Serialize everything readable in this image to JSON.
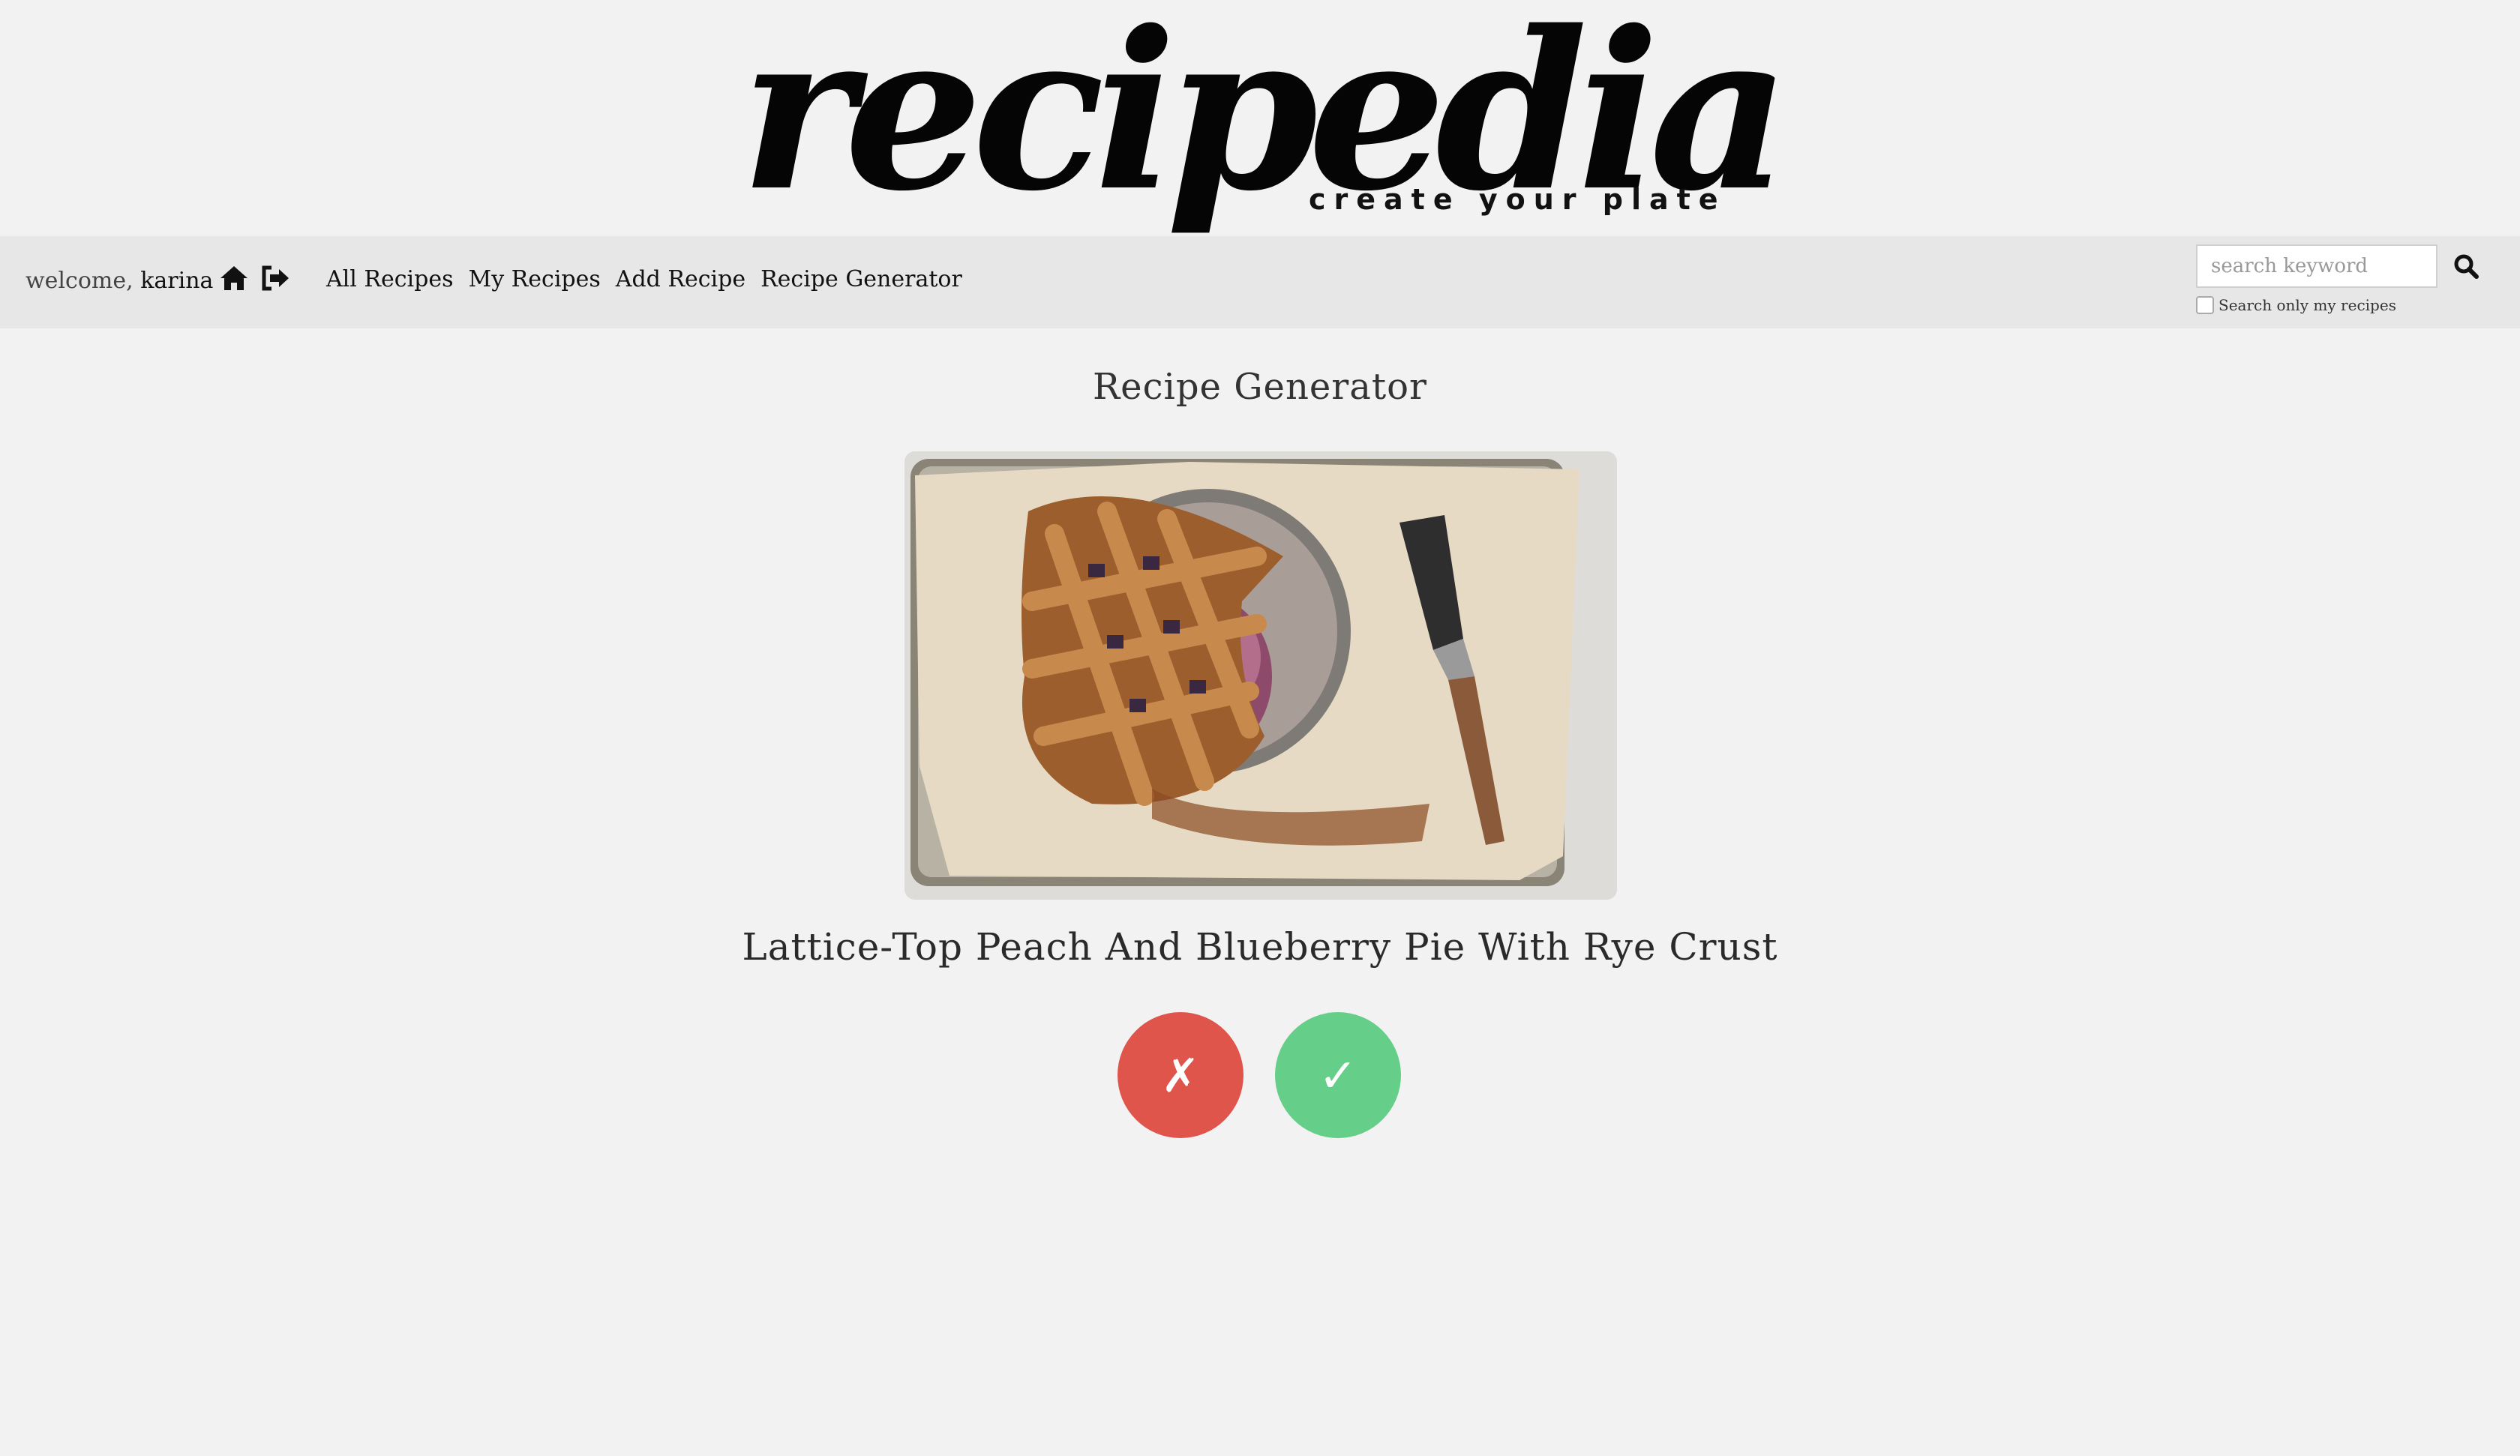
{
  "header": {
    "logo": "recipedia",
    "tagline": "create your plate"
  },
  "nav": {
    "welcome_prefix": "welcome,",
    "username": "karina",
    "icons": [
      "home-icon",
      "sign-out-icon"
    ],
    "links": [
      "All Recipes",
      "My Recipes",
      "Add Recipe",
      "Recipe Generator"
    ]
  },
  "search": {
    "placeholder": "search keyword",
    "value": "",
    "checkbox_label": "Search only my recipes",
    "checkbox_checked": false,
    "button_icon": "search-icon"
  },
  "main": {
    "title": "Recipe Generator",
    "recipe_name": "Lattice-Top Peach And Blueberry Pie With Rye Crust",
    "reject_symbol": "✗",
    "accept_symbol": "✓"
  },
  "colors": {
    "background": "#f2f2f2",
    "navbar": "#e7e7e7",
    "reject": "#e0554b",
    "accept": "#65cf89"
  }
}
